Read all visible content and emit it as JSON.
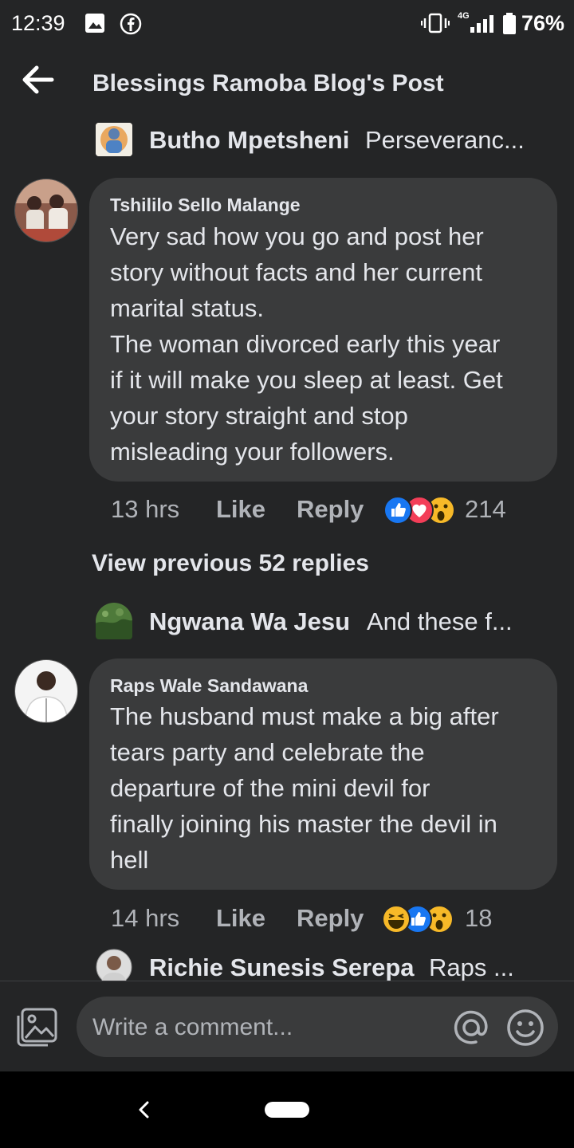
{
  "status_bar": {
    "time": "12:39",
    "network": "4G",
    "battery": "76%",
    "icons": [
      "image-icon",
      "facebook-icon",
      "vibrate-icon",
      "signal-icon",
      "battery-icon"
    ]
  },
  "header": {
    "title": "Blessings Ramoba Blog's Post"
  },
  "reply_preview_1": {
    "name": "Butho Mpetsheni",
    "text": "Perseveranc..."
  },
  "comment_1": {
    "author": "Tshililo Sello Malange",
    "lines": [
      "Very sad how you go and post her",
      "story without facts and her current",
      "marital status.",
      "The woman divorced early this year",
      "if it will make you sleep at least. Get",
      "your story straight and stop",
      "misleading your followers."
    ],
    "time": "13 hrs",
    "like": "Like",
    "reply": "Reply",
    "reaction_count": "214"
  },
  "view_previous": "View previous 52 replies",
  "reply_preview_2": {
    "name": "Ngwana Wa Jesu",
    "text": "And these f..."
  },
  "comment_2": {
    "author": "Raps Wale Sandawana",
    "lines": [
      "The husband must make a big after",
      "tears party and celebrate the",
      "departure of the mini devil for",
      "finally joining his master the devil in",
      "hell"
    ],
    "time": "14 hrs",
    "like": "Like",
    "reply": "Reply",
    "reaction_count": "18"
  },
  "reply_preview_3": {
    "name": "Richie Sunesis Serepa",
    "text": "Raps ..."
  },
  "composer": {
    "placeholder": "Write a comment..."
  },
  "colors": {
    "background": "#242526",
    "bubble": "#3a3b3c",
    "text": "#e4e6eb",
    "secondary_text": "#b0b3b8",
    "like_blue": "#1877f2",
    "love_red": "#f33e58",
    "wow_yellow": "#f7b928"
  }
}
